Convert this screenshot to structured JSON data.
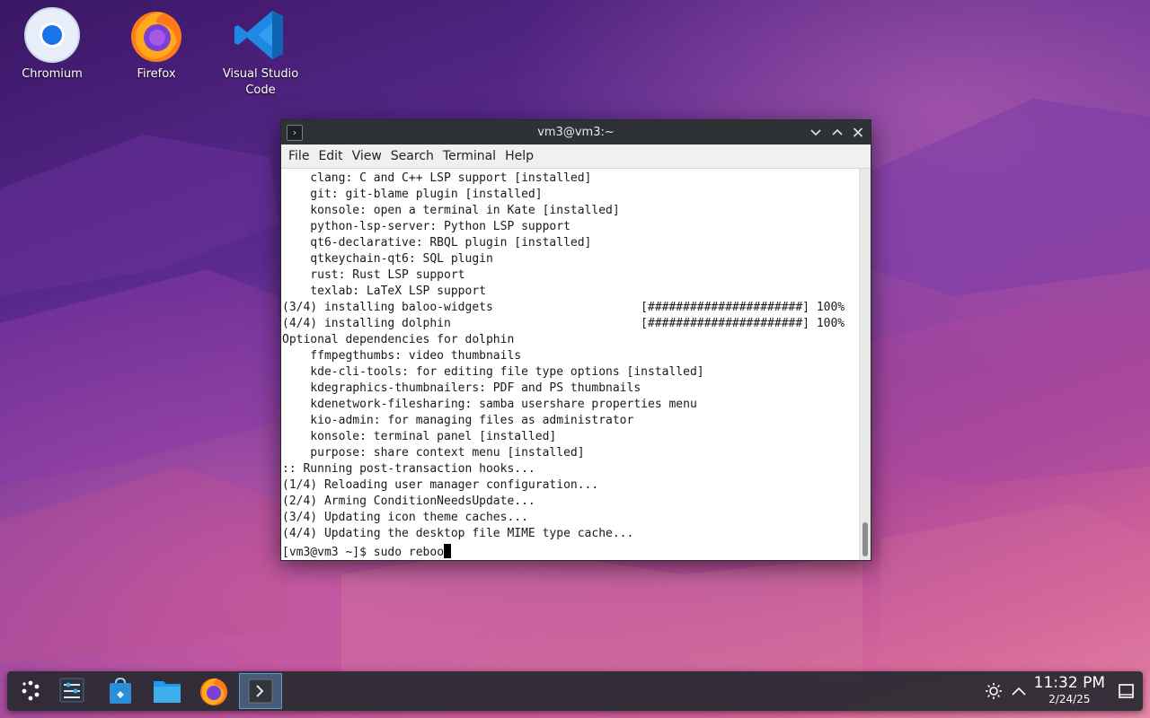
{
  "desktop": {
    "icons": [
      {
        "label": "Chromium",
        "icon": "chromium-icon"
      },
      {
        "label": "Firefox",
        "icon": "firefox-icon"
      },
      {
        "label": "Visual Studio Code",
        "icon": "vscode-icon"
      }
    ]
  },
  "window": {
    "title": "vm3@vm3:~",
    "menu": [
      "File",
      "Edit",
      "View",
      "Search",
      "Terminal",
      "Help"
    ],
    "lines": [
      "    clang: C and C++ LSP support [installed]",
      "    git: git-blame plugin [installed]",
      "    konsole: open a terminal in Kate [installed]",
      "    python-lsp-server: Python LSP support",
      "    qt6-declarative: RBQL plugin [installed]",
      "    qtkeychain-qt6: SQL plugin",
      "    rust: Rust LSP support",
      "    texlab: LaTeX LSP support",
      "(3/4) installing baloo-widgets                     [######################] 100%",
      "(4/4) installing dolphin                           [######################] 100%",
      "Optional dependencies for dolphin",
      "    ffmpegthumbs: video thumbnails",
      "    kde-cli-tools: for editing file type options [installed]",
      "    kdegraphics-thumbnailers: PDF and PS thumbnails",
      "    kdenetwork-filesharing: samba usershare properties menu",
      "    kio-admin: for managing files as administrator",
      "    konsole: terminal panel [installed]",
      "    purpose: share context menu [installed]",
      ":: Running post-transaction hooks...",
      "(1/4) Reloading user manager configuration...",
      "(2/4) Arming ConditionNeedsUpdate...",
      "(3/4) Updating icon theme caches...",
      "(4/4) Updating the desktop file MIME type cache..."
    ],
    "prompt": "[vm3@vm3 ~]$ ",
    "command": "sudo reboo",
    "scroll_position": 1.0
  },
  "taskbar": {
    "launchers": [
      "app-launcher-icon",
      "system-settings-icon",
      "discover-store-icon",
      "dolphin-files-icon",
      "firefox-icon",
      "konsole-terminal-icon"
    ],
    "time": "11:32 PM",
    "date": "2/24/25",
    "tray": [
      "brightness-icon",
      "tray-expand-icon",
      "show-desktop-icon"
    ]
  }
}
